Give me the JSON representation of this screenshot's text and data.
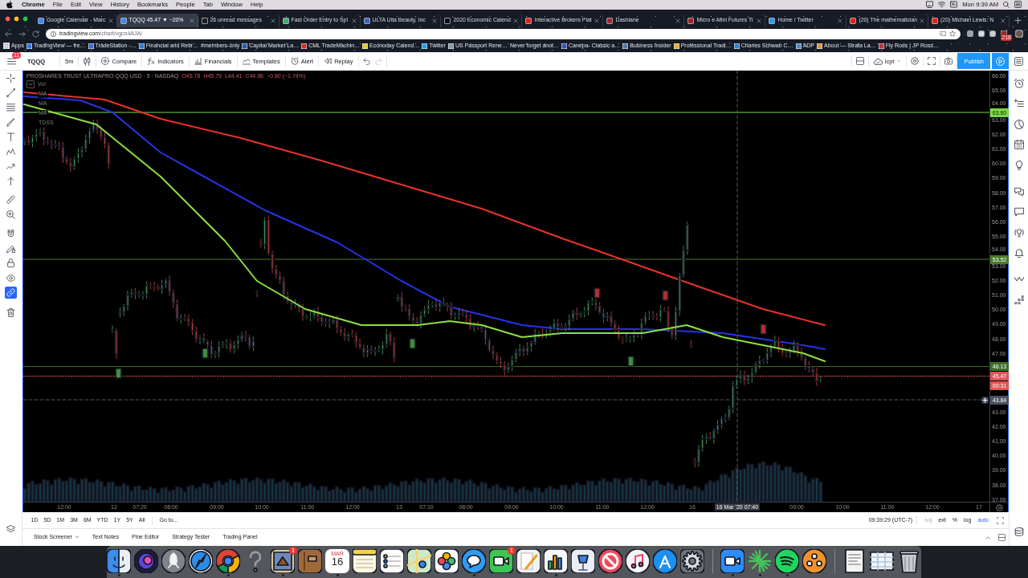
{
  "menu_bar": {
    "app": "Chrome",
    "menus": [
      "File",
      "Edit",
      "View",
      "History",
      "Bookmarks",
      "People",
      "Tab",
      "Window",
      "Help"
    ],
    "clock": "Mon 9:39 AM"
  },
  "browser": {
    "tabs": [
      {
        "title": "Google Calendar - Marc",
        "selected": false,
        "color": "#4285f4"
      },
      {
        "title": "TQQQ 45.47 ▼ −20%",
        "selected": true,
        "color": "#3b8ee8"
      },
      {
        "title": "26 unread messages",
        "selected": false,
        "color": "#1d1d1d"
      },
      {
        "title": "Fast Order Entry to Spl",
        "selected": false,
        "color": "#3ab36b"
      },
      {
        "title": "ULTA Ulta Beauty, Inc",
        "selected": false,
        "color": "#3b66c4"
      },
      {
        "title": "2020 Economic Calend",
        "selected": false,
        "color": "#101010"
      },
      {
        "title": "Interactive Brokers Plat",
        "selected": false,
        "color": "#e62117"
      },
      {
        "title": "Dashlane",
        "selected": false,
        "color": "#b0222b"
      },
      {
        "title": "Micro e-Mini Futures Ti",
        "selected": false,
        "color": "#a0202a"
      },
      {
        "title": "Home / Twitter",
        "selected": false,
        "color": "#1da1f2"
      },
      {
        "title": "(20) The mathematician",
        "selected": false,
        "color": "#e62117"
      },
      {
        "title": "(20) Michael Lewis: N",
        "selected": false,
        "color": "#e62117"
      }
    ],
    "address": {
      "domain": "tradingview.com",
      "path": "/chart/vgcn4AJA/"
    },
    "extension_badge": "218",
    "bookmarks": [
      {
        "label": "Apps",
        "kind": "apps"
      },
      {
        "label": "TradingView — fre…",
        "kind": "link",
        "color": "#2f7ae5"
      },
      {
        "label": "TradeStation -…",
        "kind": "link",
        "color": "#3b6fd1"
      },
      {
        "label": "Financial and Retir…",
        "kind": "link",
        "color": "#2e7bd6"
      },
      {
        "label": "#members-only",
        "kind": "plain"
      },
      {
        "label": "Capital Market La…",
        "kind": "link",
        "color": "#2b59a8"
      },
      {
        "label": "CML TradeMachin…",
        "kind": "link",
        "color": "#d62d20"
      },
      {
        "label": "Econoday Calend…",
        "kind": "link",
        "color": "#e8c33a"
      },
      {
        "label": "Twitter",
        "kind": "link",
        "color": "#1da1f2"
      },
      {
        "label": "US Passport Rene…",
        "kind": "link",
        "color": "#8899aa"
      },
      {
        "label": "Never forget anot…",
        "kind": "plain"
      },
      {
        "label": "Canepa- Classic a…",
        "kind": "link",
        "color": "#3355aa"
      },
      {
        "label": "Business Insider",
        "kind": "link",
        "color": "#5577aa"
      },
      {
        "label": "Professional Tradi…",
        "kind": "link",
        "color": "#e8b030"
      },
      {
        "label": "Charles Schwab C…",
        "kind": "link",
        "color": "#2f80c8"
      },
      {
        "label": "ADP",
        "kind": "link",
        "color": "#4a90c2"
      },
      {
        "label": "About — Strata La…",
        "kind": "link",
        "color": "#d89a40"
      },
      {
        "label": "Fly Rods | JP Ross…",
        "kind": "link",
        "color": "#c0303c"
      }
    ]
  },
  "chart_toolbar": {
    "menu_badge": "11",
    "symbol": "TQQQ",
    "interval": "5m",
    "buttons": [
      {
        "label": "Compare",
        "kind": "compare"
      },
      {
        "label": "Indicators",
        "kind": "indicators"
      },
      {
        "label": "Financials",
        "kind": "financials"
      },
      {
        "label": "Templates",
        "kind": "templates"
      },
      {
        "label": "Alert",
        "kind": "alert"
      },
      {
        "label": "Replay",
        "kind": "replay"
      }
    ],
    "layout_name": "icpt",
    "publish": "Publish"
  },
  "left_toolbar": [
    {
      "kind": "crosshair",
      "active": false
    },
    {
      "kind": "trendline",
      "active": false
    },
    {
      "kind": "fib",
      "active": false
    },
    {
      "kind": "brush",
      "active": false
    },
    {
      "kind": "text",
      "active": false
    },
    {
      "kind": "pattern",
      "active": false
    },
    {
      "kind": "forecast",
      "active": false
    },
    {
      "kind": "arrow",
      "active": false
    },
    {
      "kind": "ruler",
      "active": false
    },
    {
      "kind": "zoom",
      "active": false
    },
    {
      "kind": "magnet",
      "active": false
    },
    {
      "kind": "penlock",
      "active": false
    },
    {
      "kind": "lock",
      "active": false
    },
    {
      "kind": "eye",
      "active": false
    },
    {
      "kind": "link",
      "active": true
    },
    {
      "kind": "trash",
      "active": false
    }
  ],
  "right_sidebar": [
    {
      "kind": "alarm"
    },
    {
      "kind": "watchlist"
    },
    {
      "kind": "clock"
    },
    {
      "kind": "calendar"
    },
    {
      "kind": "idea"
    },
    {
      "kind": "chats"
    },
    {
      "kind": "chat"
    },
    {
      "kind": "broadcast"
    },
    {
      "kind": "bell"
    },
    {
      "kind": "zigzag"
    },
    {
      "kind": "dots"
    }
  ],
  "chart": {
    "legend": {
      "title": "PROSHARES TRUST ULTRAPRO QQQ USD · 5 · NASDAQ",
      "values": [
        "O45.78",
        "H45.79",
        "L44.41",
        "C44.98",
        "−0.80 (−1.74%)"
      ]
    },
    "indicators": [
      {
        "label": "Vol",
        "kind": "collapsible"
      },
      {
        "label": "MA",
        "kind": "plain"
      },
      {
        "label": "MA",
        "kind": "plain"
      },
      {
        "label": "MA",
        "kind": "plain"
      },
      {
        "label": "TDSS",
        "kind": "plain"
      }
    ],
    "price_axis": [
      "66.00",
      "65.00",
      "64.00",
      "63.00",
      "62.00",
      "61.00",
      "60.00",
      "59.00",
      "58.00",
      "57.00",
      "56.00",
      "55.00",
      "54.00",
      "53.00",
      "52.00",
      "51.00",
      "50.00",
      "49.00",
      "48.00",
      "47.00",
      "43.00",
      "42.00",
      "41.00",
      "40.00",
      "39.00",
      "38.00",
      "37.00"
    ],
    "price_tags": [
      {
        "label": "63.60",
        "kind": "level",
        "color": "#79d94a"
      },
      {
        "label": "53.52",
        "kind": "level",
        "color": "#4b7a2c"
      },
      {
        "label": "46.13",
        "kind": "level",
        "color": "#3f6f2c"
      },
      {
        "label": "45.47",
        "kind": "price",
        "color": "#e05555"
      },
      {
        "label": "00:31",
        "kind": "countdown",
        "color": "#e05555"
      },
      {
        "label": "43.84",
        "kind": "crosshair",
        "color": "#4b5261"
      }
    ],
    "time_axis": [
      {
        "label": "12:00",
        "highlighted": false
      },
      {
        "label": "12",
        "highlighted": false
      },
      {
        "label": "07:20",
        "highlighted": false
      },
      {
        "label": "08:00",
        "highlighted": false
      },
      {
        "label": "09:00",
        "highlighted": false
      },
      {
        "label": "10:00",
        "highlighted": false
      },
      {
        "label": "11:00",
        "highlighted": false
      },
      {
        "label": "12:00",
        "highlighted": false
      },
      {
        "label": "13",
        "highlighted": false
      },
      {
        "label": "07:10",
        "highlighted": false
      },
      {
        "label": "08:00",
        "highlighted": false
      },
      {
        "label": "09:00",
        "highlighted": false
      },
      {
        "label": "10:00",
        "highlighted": false
      },
      {
        "label": "11:00",
        "highlighted": false
      },
      {
        "label": "12:00",
        "highlighted": false
      },
      {
        "label": "16",
        "highlighted": false
      },
      {
        "label": "16 Mar '20 07:40",
        "highlighted": true
      },
      {
        "label": "09:00",
        "highlighted": false
      },
      {
        "label": "10:00",
        "highlighted": false
      },
      {
        "label": "11:00",
        "highlighted": false
      },
      {
        "label": "12:00",
        "highlighted": false
      },
      {
        "label": "17",
        "highlighted": false
      }
    ]
  },
  "range_bar": {
    "ranges": [
      "1D",
      "5D",
      "1M",
      "3M",
      "6M",
      "YTD",
      "1Y",
      "5Y",
      "All"
    ],
    "goto": "Go to...",
    "time": "09:39:29 (UTC-7)",
    "options": [
      {
        "label": "adj",
        "on": false,
        "disabled": true
      },
      {
        "label": "ext",
        "on": false,
        "disabled": false
      },
      {
        "label": "%",
        "on": false,
        "disabled": false
      },
      {
        "label": "log",
        "on": false,
        "disabled": false
      },
      {
        "label": "auto",
        "on": true,
        "disabled": false
      }
    ]
  },
  "bottom_tabs": [
    "Stock Screener",
    "Text Notes",
    "Pine Editor",
    "Strategy Tester",
    "Trading Panel"
  ],
  "dock": [
    {
      "kind": "face",
      "running": true
    },
    {
      "kind": "orb",
      "running": false
    },
    {
      "kind": "rocket",
      "running": false
    },
    {
      "kind": "compass",
      "running": false
    },
    {
      "kind": "ball",
      "running": true
    },
    {
      "kind": "question",
      "running": false
    },
    {
      "kind": "stamp",
      "running": true,
      "badge": "1"
    },
    {
      "kind": "notebook",
      "running": false
    },
    {
      "kind": "calendar",
      "running": true,
      "month": "MAR",
      "day": "16"
    },
    {
      "kind": "notepad",
      "running": false
    },
    {
      "kind": "checklist",
      "running": false
    },
    {
      "kind": "map",
      "running": false
    },
    {
      "kind": "flower",
      "running": false
    },
    {
      "kind": "bubble",
      "running": true
    },
    {
      "kind": "phone",
      "running": false,
      "badge": "1"
    },
    {
      "kind": "pen",
      "running": false
    },
    {
      "kind": "chart",
      "running": true
    },
    {
      "kind": "podium",
      "running": false
    },
    {
      "kind": "nosign",
      "running": false
    },
    {
      "kind": "note",
      "running": false
    },
    {
      "kind": "letter",
      "running": false
    },
    {
      "kind": "gear",
      "running": false
    },
    {
      "kind": "separator"
    },
    {
      "kind": "camera",
      "running": true
    },
    {
      "kind": "burst",
      "running": true
    },
    {
      "kind": "waves",
      "running": true
    },
    {
      "kind": "asterisk",
      "running": false
    },
    {
      "kind": "separator"
    },
    {
      "kind": "document",
      "running": false
    },
    {
      "kind": "sheet",
      "running": false
    },
    {
      "kind": "trash",
      "running": false
    }
  ]
}
